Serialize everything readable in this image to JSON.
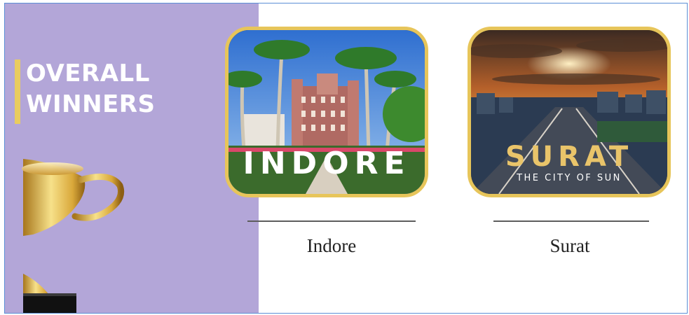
{
  "section": {
    "title_line1": "OVERALL",
    "title_line2": "WINNERS"
  },
  "winners": [
    {
      "city": "Indore",
      "overlay_text": "INDORE"
    },
    {
      "city": "Surat",
      "overlay_text": "SURAT",
      "overlay_subtext": "THE CITY OF SUN"
    }
  ],
  "colors": {
    "panel_bg": "#b3a6d8",
    "accent_gold": "#e7c55a",
    "title_text": "#ffffff",
    "frame_border": "#5b8fd6"
  },
  "icons": [
    "trophy-icon"
  ]
}
